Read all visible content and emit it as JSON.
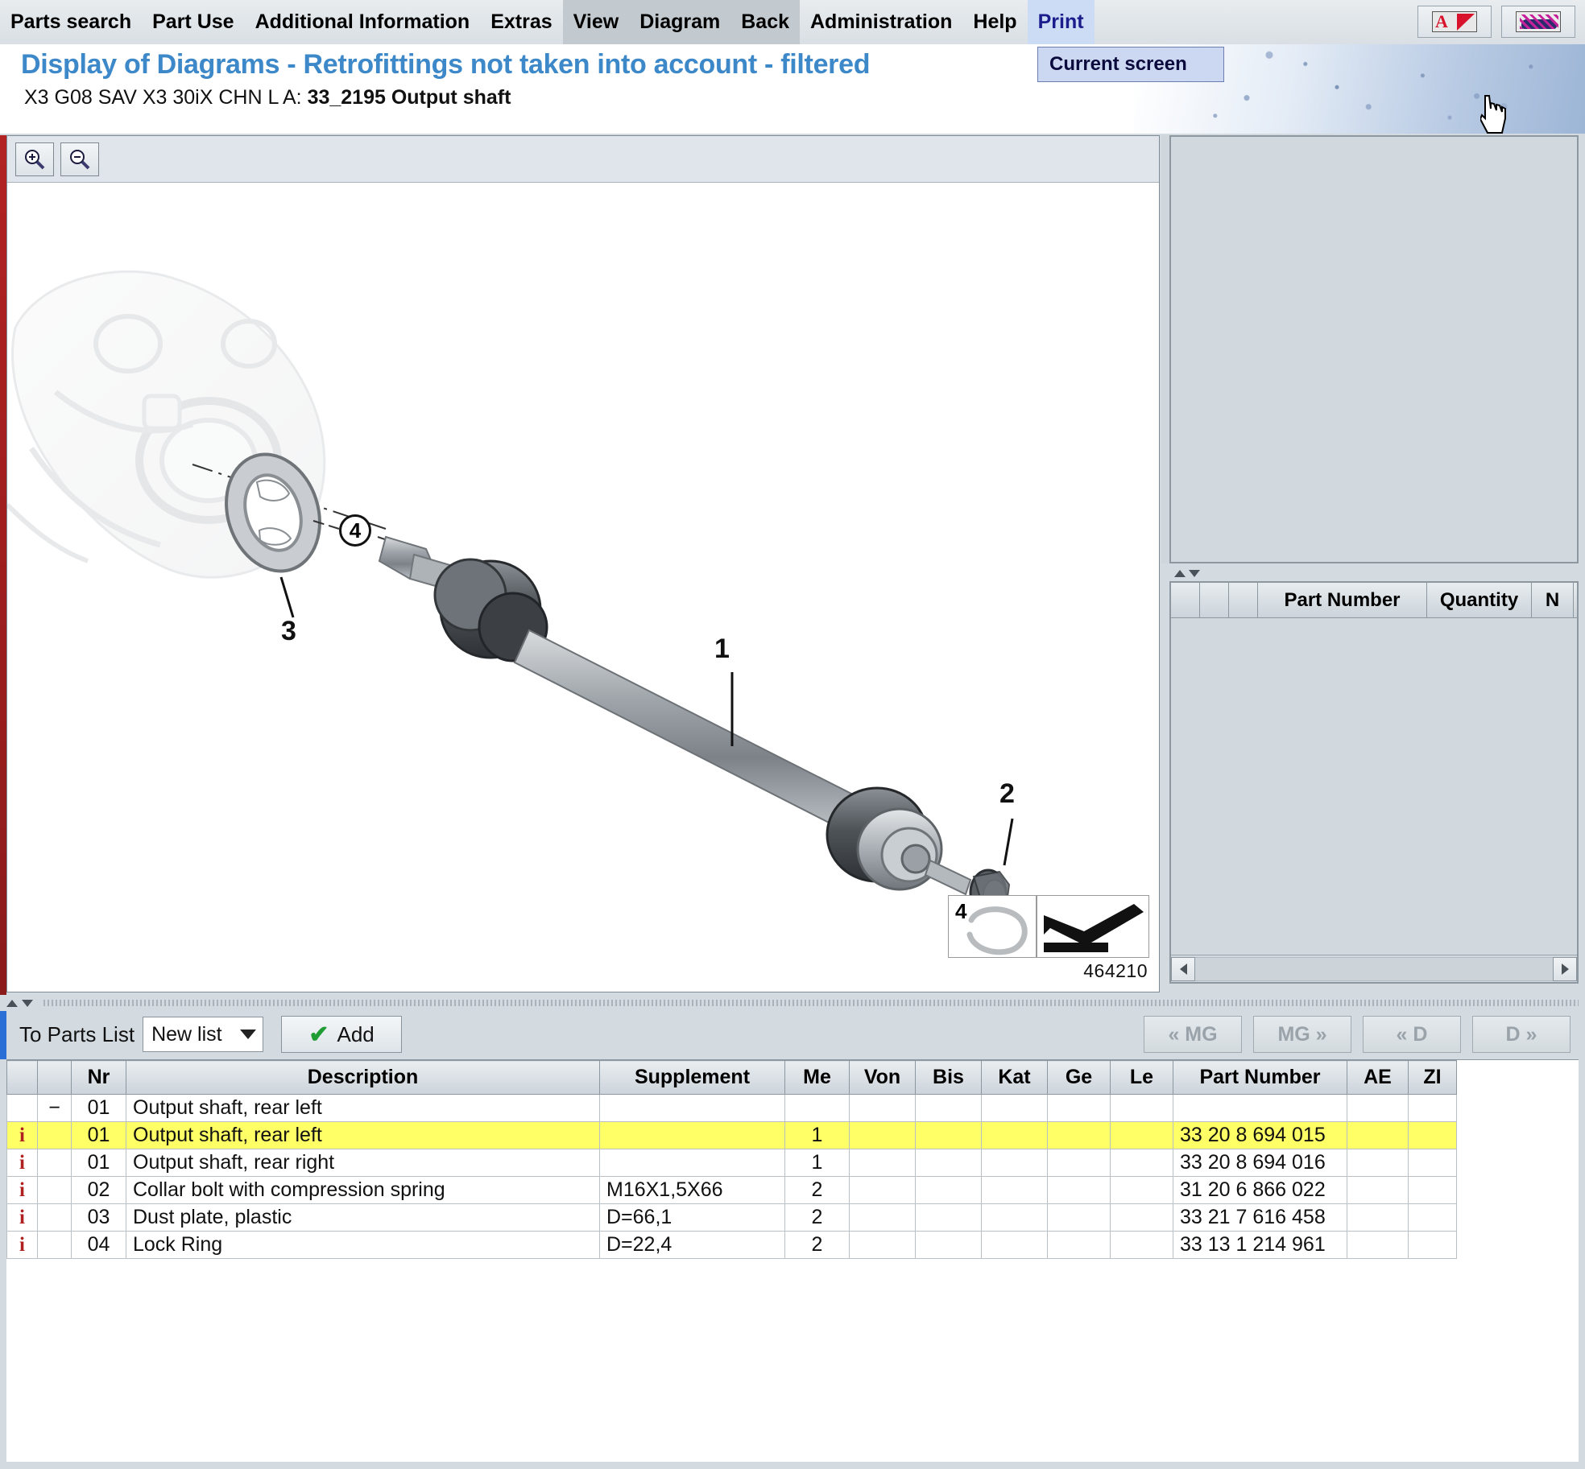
{
  "menu": {
    "items": [
      {
        "label": "Parts search",
        "state": "normal"
      },
      {
        "label": "Part Use",
        "state": "normal"
      },
      {
        "label": "Additional Information",
        "state": "normal"
      },
      {
        "label": "Extras",
        "state": "normal"
      },
      {
        "label": "View",
        "state": "grayzone"
      },
      {
        "label": "Diagram",
        "state": "grayzone"
      },
      {
        "label": "Back",
        "state": "grayzone"
      },
      {
        "label": "Administration",
        "state": "normal"
      },
      {
        "label": "Help",
        "state": "normal"
      },
      {
        "label": "Print",
        "state": "active"
      }
    ],
    "toolbar_icons": [
      {
        "name": "aos-logo-icon"
      },
      {
        "name": "car-logo-icon"
      }
    ]
  },
  "print_menu": {
    "open": true,
    "options": [
      "Current screen"
    ],
    "selected": "Current screen"
  },
  "banner": {
    "title": "Display of Diagrams - Retrofittings not taken into account - filtered",
    "subtitle_prefix": "X3 G08 SAV X3 30iX CHN  L A: ",
    "subtitle_bold": "33_2195 Output shaft",
    "title_color": "#3c88c8"
  },
  "diagram": {
    "zoom_in_label": "zoom-in",
    "zoom_out_label": "zoom-out",
    "callouts": [
      {
        "id": "1",
        "kind": "plain"
      },
      {
        "id": "2",
        "kind": "plain"
      },
      {
        "id": "3",
        "kind": "plain"
      },
      {
        "id": "4",
        "kind": "circled"
      }
    ],
    "legend": {
      "number": "4",
      "symbol": "arrow"
    },
    "diagram_id": "464210"
  },
  "right_panel": {
    "top_empty": true,
    "table": {
      "columns": [
        "",
        "",
        "",
        "Part Number",
        "Quantity",
        "N"
      ],
      "rows": []
    }
  },
  "toolstrip": {
    "label": "To Parts List",
    "list_select": {
      "value": "New list",
      "options": [
        "New list"
      ]
    },
    "add_button": "Add",
    "nav_buttons": [
      {
        "label": "« MG",
        "enabled": false
      },
      {
        "label": "MG »",
        "enabled": false
      },
      {
        "label": "« D",
        "enabled": false
      },
      {
        "label": "D »",
        "enabled": false
      }
    ]
  },
  "parts_table": {
    "columns": [
      {
        "key": "icon",
        "label": ""
      },
      {
        "key": "exp",
        "label": ""
      },
      {
        "key": "nr",
        "label": "Nr"
      },
      {
        "key": "description",
        "label": "Description"
      },
      {
        "key": "supplement",
        "label": "Supplement"
      },
      {
        "key": "me",
        "label": "Me"
      },
      {
        "key": "von",
        "label": "Von"
      },
      {
        "key": "bis",
        "label": "Bis"
      },
      {
        "key": "kat",
        "label": "Kat"
      },
      {
        "key": "ge",
        "label": "Ge"
      },
      {
        "key": "le",
        "label": "Le"
      },
      {
        "key": "part_number",
        "label": "Part Number"
      },
      {
        "key": "ae",
        "label": "AE"
      },
      {
        "key": "zi",
        "label": "ZI"
      }
    ],
    "rows": [
      {
        "icon": "",
        "exp": "−",
        "nr": "01",
        "description": "Output shaft, rear left",
        "supplement": "",
        "me": "",
        "von": "",
        "bis": "",
        "kat": "",
        "ge": "",
        "le": "",
        "part_number": "",
        "ae": "",
        "zi": "",
        "selected": false
      },
      {
        "icon": "i",
        "exp": "",
        "nr": "01",
        "description": "Output shaft, rear left",
        "supplement": "",
        "me": "1",
        "von": "",
        "bis": "",
        "kat": "",
        "ge": "",
        "le": "",
        "part_number": "33 20 8 694 015",
        "ae": "",
        "zi": "",
        "selected": true
      },
      {
        "icon": "i",
        "exp": "",
        "nr": "01",
        "description": "Output shaft, rear right",
        "supplement": "",
        "me": "1",
        "von": "",
        "bis": "",
        "kat": "",
        "ge": "",
        "le": "",
        "part_number": "33 20 8 694 016",
        "ae": "",
        "zi": "",
        "selected": false
      },
      {
        "icon": "i",
        "exp": "",
        "nr": "02",
        "description": "Collar bolt with compression spring",
        "supplement": "M16X1,5X66",
        "me": "2",
        "von": "",
        "bis": "",
        "kat": "",
        "ge": "",
        "le": "",
        "part_number": "31 20 6 866 022",
        "ae": "",
        "zi": "",
        "selected": false
      },
      {
        "icon": "i",
        "exp": "",
        "nr": "03",
        "description": "Dust plate, plastic",
        "supplement": "D=66,1",
        "me": "2",
        "von": "",
        "bis": "",
        "kat": "",
        "ge": "",
        "le": "",
        "part_number": "33 21 7 616 458",
        "ae": "",
        "zi": "",
        "selected": false
      },
      {
        "icon": "i",
        "exp": "",
        "nr": "04",
        "description": "Lock Ring",
        "supplement": "D=22,4",
        "me": "2",
        "von": "",
        "bis": "",
        "kat": "",
        "ge": "",
        "le": "",
        "part_number": "33 13 1 214 961",
        "ae": "",
        "zi": "",
        "selected": false
      }
    ],
    "selected_row_color": "#ffff66"
  }
}
